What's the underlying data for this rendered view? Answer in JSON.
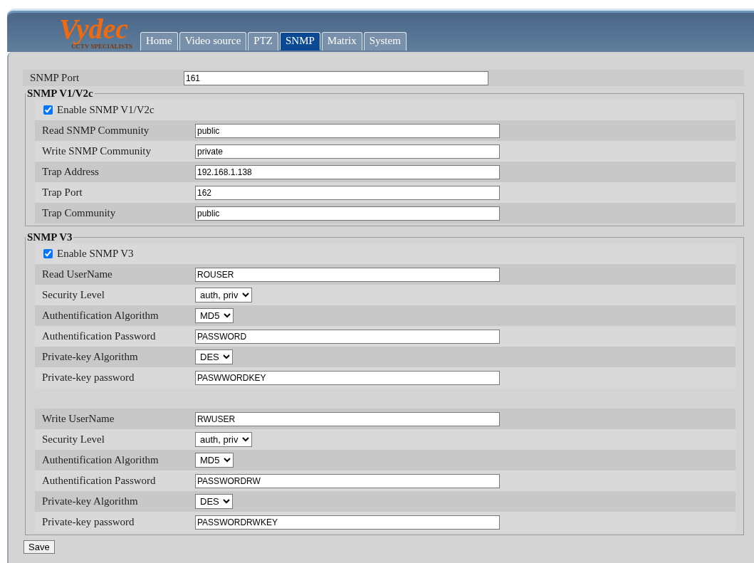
{
  "logo": {
    "name": "Vydec",
    "tagline": "CCTV SPECIALISTS"
  },
  "tabs": [
    {
      "label": "Home",
      "selected": false
    },
    {
      "label": "Video source",
      "selected": false
    },
    {
      "label": "PTZ",
      "selected": false
    },
    {
      "label": "SNMP",
      "selected": true
    },
    {
      "label": "Matrix",
      "selected": false
    },
    {
      "label": "System",
      "selected": false
    }
  ],
  "port": {
    "label": "SNMP Port",
    "value": "161"
  },
  "sections": [
    {
      "legend": "SNMP V1/V2c",
      "enable": {
        "label": "Enable SNMP V1/V2c",
        "checked": true
      },
      "groups": [
        [
          {
            "kind": "text",
            "label": "Read SNMP Community",
            "value": "public"
          },
          {
            "kind": "text",
            "label": "Write SNMP Community",
            "value": "private"
          },
          {
            "kind": "text",
            "label": "Trap Address",
            "value": "192.168.1.138"
          },
          {
            "kind": "text",
            "label": "Trap Port",
            "value": "162"
          },
          {
            "kind": "text",
            "label": "Trap Community",
            "value": "public"
          }
        ]
      ]
    },
    {
      "legend": "SNMP V3",
      "enable": {
        "label": "Enable SNMP V3",
        "checked": true
      },
      "groups": [
        [
          {
            "kind": "text",
            "label": "Read UserName",
            "value": "ROUSER"
          },
          {
            "kind": "select",
            "label": "Security Level",
            "value": "auth, priv"
          },
          {
            "kind": "select",
            "label": "Authentification Algorithm",
            "value": "MD5"
          },
          {
            "kind": "text",
            "label": "Authentification Password",
            "value": "PASSWORD"
          },
          {
            "kind": "select",
            "label": "Private-key Algorithm",
            "value": "DES"
          },
          {
            "kind": "text",
            "label": "Private-key password",
            "value": "PASWWORDKEY"
          }
        ],
        [
          {
            "kind": "text",
            "label": "Write UserName",
            "value": "RWUSER"
          },
          {
            "kind": "select",
            "label": "Security Level",
            "value": "auth, priv"
          },
          {
            "kind": "select",
            "label": "Authentification Algorithm",
            "value": "MD5"
          },
          {
            "kind": "text",
            "label": "Authentification Password",
            "value": "PASSWORDRW"
          },
          {
            "kind": "select",
            "label": "Private-key Algorithm",
            "value": "DES"
          },
          {
            "kind": "text",
            "label": "Private-key password",
            "value": "PASSWORDRWKEY"
          }
        ]
      ]
    }
  ],
  "save": "Save"
}
